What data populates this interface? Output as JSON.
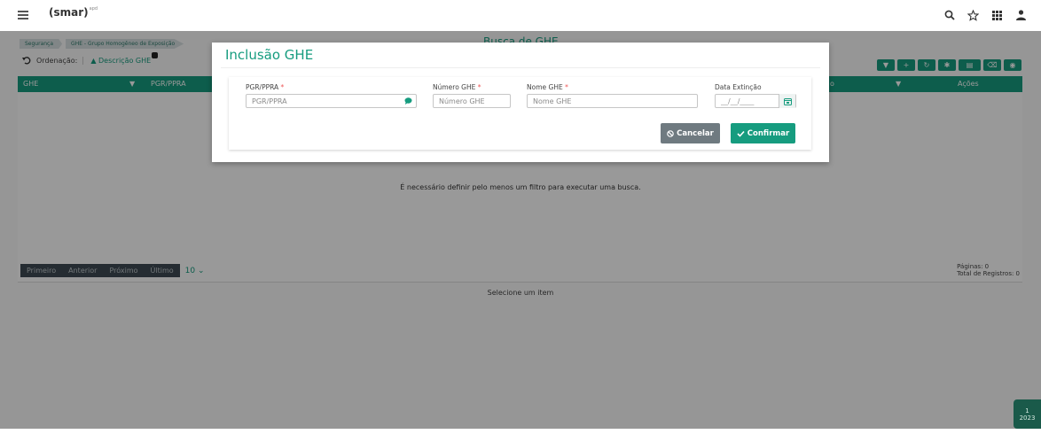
{
  "app": {
    "logo": "(smar)",
    "logo_sup": "apd"
  },
  "breadcrumb": [
    "Segurança",
    "GHE - Grupo Homogêneo de Exposição"
  ],
  "page": {
    "title": "Busca de GHE",
    "ordering_label": "Ordenação:",
    "ordering_value": "Descrição GHE",
    "columns": [
      "GHE",
      "PGR/PPRA",
      "o",
      "Ações"
    ],
    "empty_message": "É necessário definir pelo menos um filtro para executar uma busca.",
    "select_message": "Selecione um item",
    "pager": {
      "first": "Primeiro",
      "prev": "Anterior",
      "next": "Próximo",
      "last": "Último",
      "page_size": "10"
    },
    "info": {
      "pages": "Páginas: 0",
      "total": "Total de Registros: 0"
    }
  },
  "modal": {
    "title": "Inclusão GHE",
    "fields": {
      "pgr": {
        "label": "PGR/PPRA",
        "required": "*",
        "placeholder": "PGR/PPRA"
      },
      "numero": {
        "label": "Número GHE",
        "required": "*",
        "placeholder": "Número GHE"
      },
      "nome": {
        "label": "Nome GHE",
        "required": "*",
        "placeholder": "Nome GHE"
      },
      "data": {
        "label": "Data Extinção",
        "placeholder": "__/__/____"
      }
    },
    "cancel_label": "Cancelar",
    "confirm_label": "Confirmar"
  },
  "year_badge": {
    "line1": "1",
    "line2": "2023"
  },
  "colors": {
    "accent": "#169c7f",
    "cancel": "#6f7a80",
    "pager": "#3e4a54"
  }
}
